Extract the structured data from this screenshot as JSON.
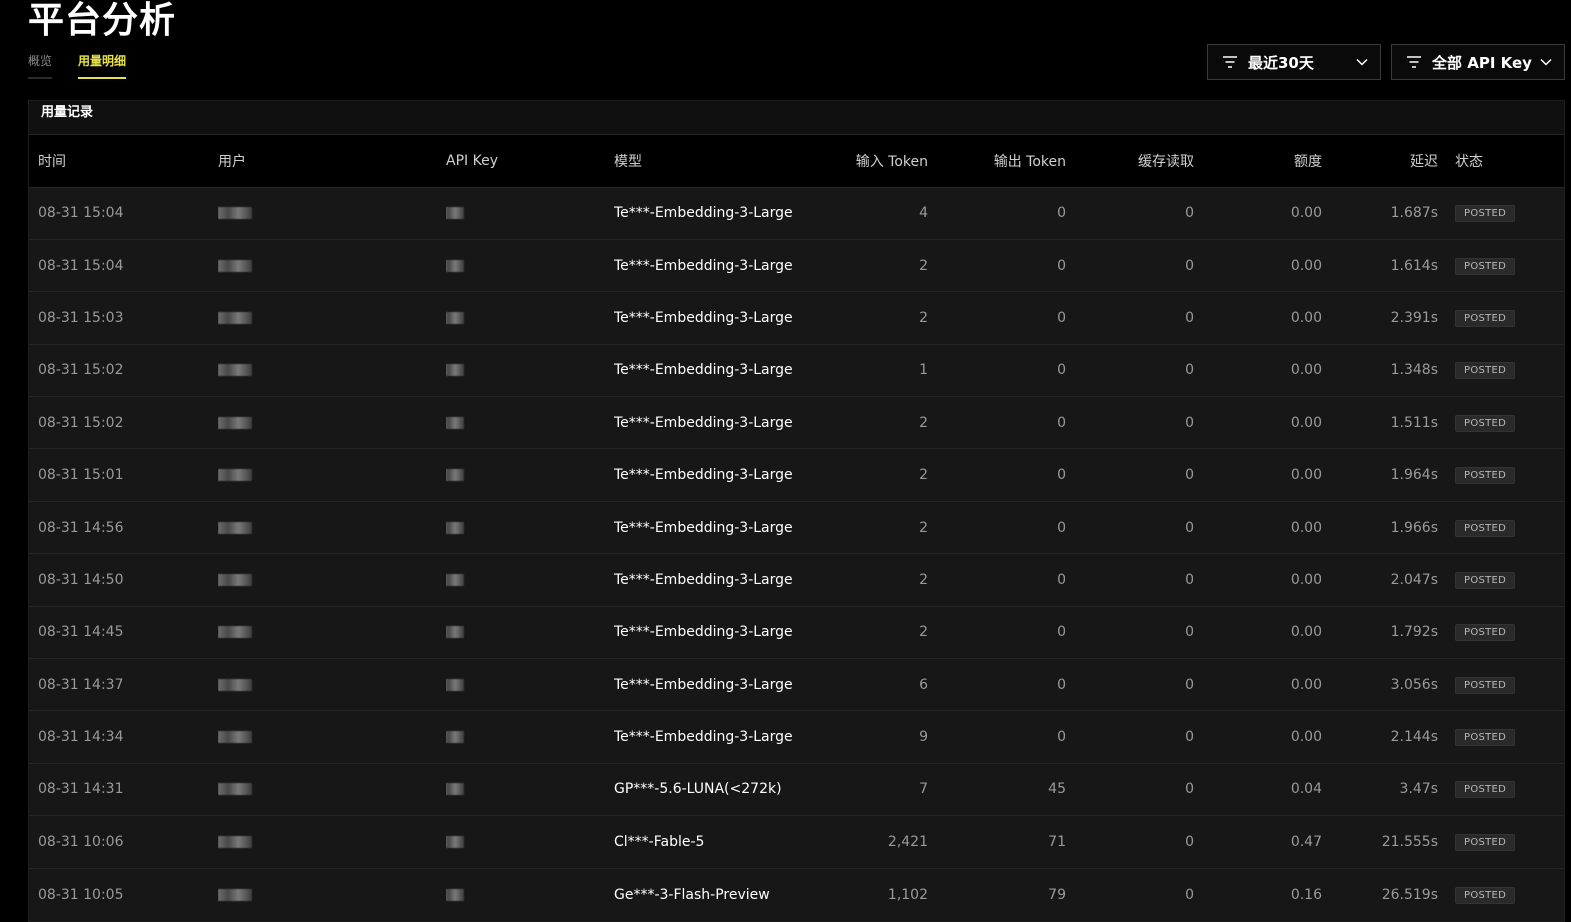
{
  "page": {
    "title": "平台分析"
  },
  "tabs": [
    {
      "label": "概览",
      "active": false
    },
    {
      "label": "用量明细",
      "active": true
    }
  ],
  "filters": {
    "range_label": "最近30天",
    "key_label": "全部 API Key"
  },
  "panel": {
    "title": "用量记录"
  },
  "table": {
    "headers": {
      "time": "时间",
      "user": "用户",
      "api_key": "API Key",
      "model": "模型",
      "input_token": "输入 Token",
      "output_token": "输出 Token",
      "cache_read": "缓存读取",
      "quota": "额度",
      "latency": "延迟",
      "status": "状态"
    },
    "rows": [
      {
        "time": "08-31 15:04",
        "model": "Te***-Embedding-3-Large",
        "input": "4",
        "output": "0",
        "cache": "0",
        "quota": "0.00",
        "latency": "1.687s",
        "status": "POSTED"
      },
      {
        "time": "08-31 15:04",
        "model": "Te***-Embedding-3-Large",
        "input": "2",
        "output": "0",
        "cache": "0",
        "quota": "0.00",
        "latency": "1.614s",
        "status": "POSTED"
      },
      {
        "time": "08-31 15:03",
        "model": "Te***-Embedding-3-Large",
        "input": "2",
        "output": "0",
        "cache": "0",
        "quota": "0.00",
        "latency": "2.391s",
        "status": "POSTED"
      },
      {
        "time": "08-31 15:02",
        "model": "Te***-Embedding-3-Large",
        "input": "1",
        "output": "0",
        "cache": "0",
        "quota": "0.00",
        "latency": "1.348s",
        "status": "POSTED"
      },
      {
        "time": "08-31 15:02",
        "model": "Te***-Embedding-3-Large",
        "input": "2",
        "output": "0",
        "cache": "0",
        "quota": "0.00",
        "latency": "1.511s",
        "status": "POSTED"
      },
      {
        "time": "08-31 15:01",
        "model": "Te***-Embedding-3-Large",
        "input": "2",
        "output": "0",
        "cache": "0",
        "quota": "0.00",
        "latency": "1.964s",
        "status": "POSTED"
      },
      {
        "time": "08-31 14:56",
        "model": "Te***-Embedding-3-Large",
        "input": "2",
        "output": "0",
        "cache": "0",
        "quota": "0.00",
        "latency": "1.966s",
        "status": "POSTED"
      },
      {
        "time": "08-31 14:50",
        "model": "Te***-Embedding-3-Large",
        "input": "2",
        "output": "0",
        "cache": "0",
        "quota": "0.00",
        "latency": "2.047s",
        "status": "POSTED"
      },
      {
        "time": "08-31 14:45",
        "model": "Te***-Embedding-3-Large",
        "input": "2",
        "output": "0",
        "cache": "0",
        "quota": "0.00",
        "latency": "1.792s",
        "status": "POSTED"
      },
      {
        "time": "08-31 14:37",
        "model": "Te***-Embedding-3-Large",
        "input": "6",
        "output": "0",
        "cache": "0",
        "quota": "0.00",
        "latency": "3.056s",
        "status": "POSTED"
      },
      {
        "time": "08-31 14:34",
        "model": "Te***-Embedding-3-Large",
        "input": "9",
        "output": "0",
        "cache": "0",
        "quota": "0.00",
        "latency": "2.144s",
        "status": "POSTED"
      },
      {
        "time": "08-31 14:31",
        "model": "GP***-5.6-LUNA(<272k)",
        "input": "7",
        "output": "45",
        "cache": "0",
        "quota": "0.04",
        "latency": "3.47s",
        "status": "POSTED"
      },
      {
        "time": "08-31 10:06",
        "model": "Cl***-Fable-5",
        "input": "2,421",
        "output": "71",
        "cache": "0",
        "quota": "0.47",
        "latency": "21.555s",
        "status": "POSTED"
      },
      {
        "time": "08-31 10:05",
        "model": "Ge***-3-Flash-Preview",
        "input": "1,102",
        "output": "79",
        "cache": "0",
        "quota": "0.16",
        "latency": "26.519s",
        "status": "POSTED"
      }
    ]
  },
  "colors": {
    "background": "#000000",
    "panel": "#171717",
    "accent": "#e6e14a",
    "text": "#9a9a9a",
    "badge": "#2a2a2a"
  },
  "icons": {
    "filter": "filter-icon",
    "chevron": "chevron-down-icon"
  }
}
